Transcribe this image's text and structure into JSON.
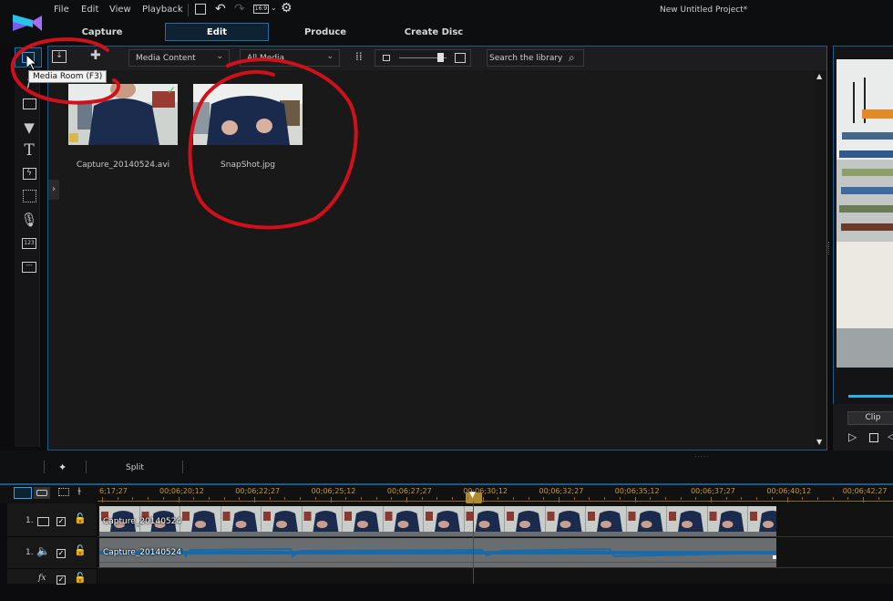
{
  "app": {
    "project_title": "New Untitled Project*",
    "brand_colors": {
      "accent": "#1d6fa5",
      "timecode": "#c99a2e",
      "annotation": "#d0101a"
    }
  },
  "menu": [
    "File",
    "Edit",
    "View",
    "Playback"
  ],
  "toolbar": {
    "save_icon": "save-icon",
    "undo_icon": "undo-icon",
    "redo_icon": "redo-icon",
    "aspect_ratio": "16:9",
    "settings_icon": "gear-icon"
  },
  "tabs": [
    {
      "label": "Capture",
      "active": false
    },
    {
      "label": "Edit",
      "active": true
    },
    {
      "label": "Produce",
      "active": false
    },
    {
      "label": "Create Disc",
      "active": false
    }
  ],
  "rail": {
    "items": [
      "media-room",
      "fx-room",
      "pip-objects",
      "particle-room",
      "title-room",
      "transition-room",
      "menu-designer",
      "voiceover-room",
      "chapter-room",
      "subtitle-room"
    ],
    "tooltip": "Media Room (F3)"
  },
  "library": {
    "content_dropdown": "Media Content",
    "filter_dropdown": "All Media",
    "search_placeholder": "Search the library",
    "thumbnail_size": 0.85,
    "items": [
      {
        "name": "Capture_20140524.avi",
        "used": true,
        "type": "video"
      },
      {
        "name": "SnapShot.jpg",
        "used": false,
        "type": "image"
      }
    ]
  },
  "preview": {
    "mode_button": "Clip"
  },
  "midbar": {
    "split_label": "Split"
  },
  "timeline": {
    "timecodes": [
      "6;17;27",
      "00;06;20;12",
      "00;06;22;27",
      "00;06;25;12",
      "00;06;27;27",
      "00;06;30;12",
      "00;06;32;27",
      "00;06;35;12",
      "00;06;37;27",
      "00;06;40;12",
      "00;06;42;27"
    ],
    "tracks": [
      {
        "number": "1.",
        "type": "video",
        "enabled": true,
        "clip": "Capture_20140524"
      },
      {
        "number": "1.",
        "type": "audio",
        "enabled": true,
        "clip": "Capture_20140524"
      },
      {
        "number": "fx",
        "type": "effect",
        "enabled": true,
        "clip": ""
      }
    ]
  }
}
